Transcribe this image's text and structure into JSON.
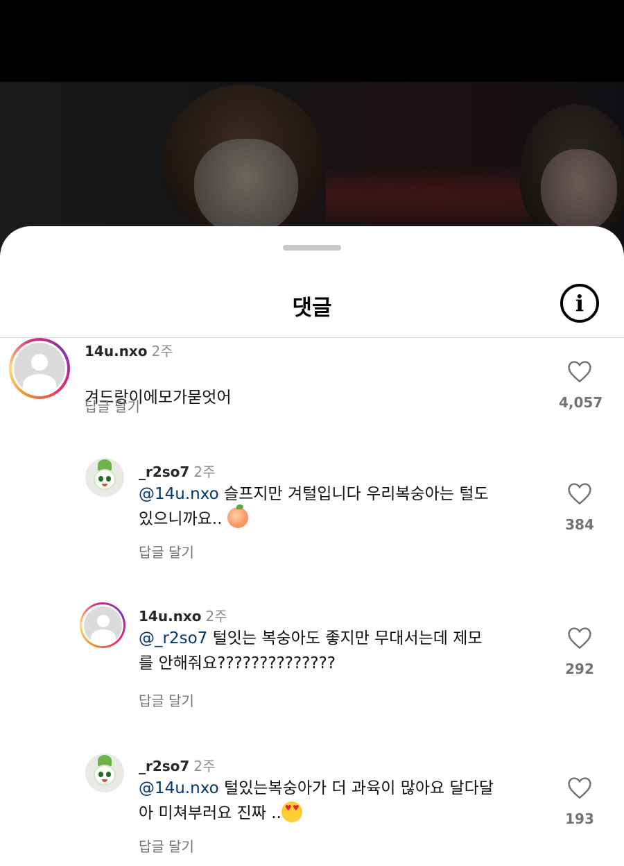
{
  "sheet": {
    "title": "댓글"
  },
  "comments": [
    {
      "username": "14u.nxo",
      "time": "2주",
      "mention": "",
      "text": "겨드랑이에모가묻엇어",
      "reply_label": "답글 달기",
      "likes": "4,057",
      "avatar": "default-avatar",
      "story_ring": true
    },
    {
      "username": "_r2so7",
      "time": "2주",
      "mention": "@14u.nxo",
      "text": " 슬프지만 겨털입니다 우리복숭아는 털도\n있으니까요..",
      "emoji": "peach",
      "reply_label": "답글 달기",
      "likes": "384",
      "avatar": "character-avatar",
      "story_ring": false
    },
    {
      "username": "14u.nxo",
      "time": "2주",
      "mention": "@_r2so7",
      "text": " 털잇는 복숭아도 좋지만 무대서는데 제모\n를 안해줘요??????????????",
      "reply_label": "답글 달기",
      "likes": "292",
      "avatar": "default-avatar",
      "story_ring": true
    },
    {
      "username": "_r2so7",
      "time": "2주",
      "mention": "@14u.nxo",
      "text": " 털있는복숭아가 더 과육이 많아요 달다달\n아 미쳐부러요 진짜 ..",
      "emoji": "smiling-face-with-heart-eyes",
      "reply_label": "답글 달기",
      "likes": "193",
      "avatar": "character-avatar",
      "story_ring": false
    }
  ],
  "colors": {
    "mention": "#00376b",
    "secondary_text": "#737373",
    "sheet_background": "#ffffff"
  }
}
